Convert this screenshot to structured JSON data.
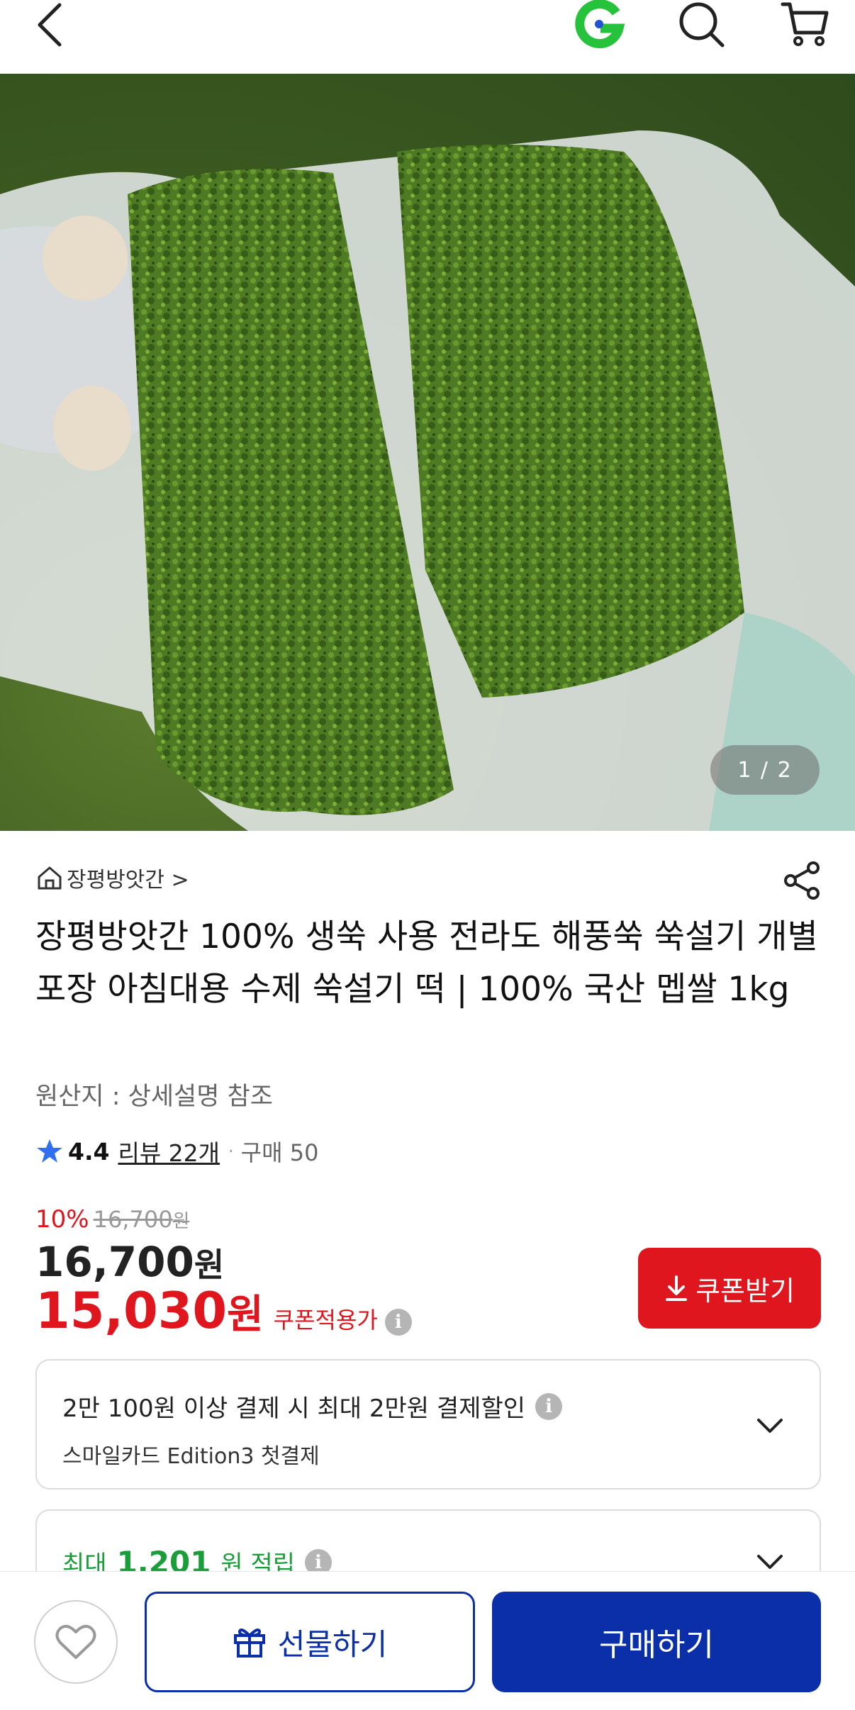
{
  "header": {
    "back_icon": "chevron-left-icon",
    "logo_icon": "g-logo-icon",
    "logo_color": "#27c23b",
    "search_icon": "search-icon",
    "cart_icon": "cart-icon"
  },
  "gallery": {
    "pager": "1 / 2"
  },
  "product": {
    "store_name": "장평방앗간 >",
    "title": "장평방앗간 100% 생쑥 사용 전라도 해풍쑥 쑥설기 개별포장 아침대용 수제 쑥설기 떡 | 100% 국산 멥쌀 1kg",
    "origin": "원산지 : 상세설명 참조",
    "rating": "4.4",
    "review_count": "리뷰 22개",
    "dot": "·",
    "purchase_count": "구매 50"
  },
  "pricing": {
    "discount_rate": "10%",
    "original_price": "16,700",
    "original_won": "원",
    "price": "16,700",
    "price_won": "원",
    "coupon_price": "15,030",
    "coupon_won": "원",
    "coupon_label": "쿠폰적용가",
    "coupon_button": "쿠폰받기",
    "accent_color": "#e0161f"
  },
  "benefits": {
    "card_discount": "2만 100원 이상 결제 시 최대 2만원 결제할인",
    "card_name": "스마일카드 Edition3 첫결제",
    "points_prefix": "최대",
    "points_amount": "1,201",
    "points_suffix": "원 적립"
  },
  "bottom_bar": {
    "wish_icon": "heart-icon",
    "gift_label": "선물하기",
    "buy_label": "구매하기",
    "primary_color": "#0a2fa8"
  },
  "info_icon": "i"
}
